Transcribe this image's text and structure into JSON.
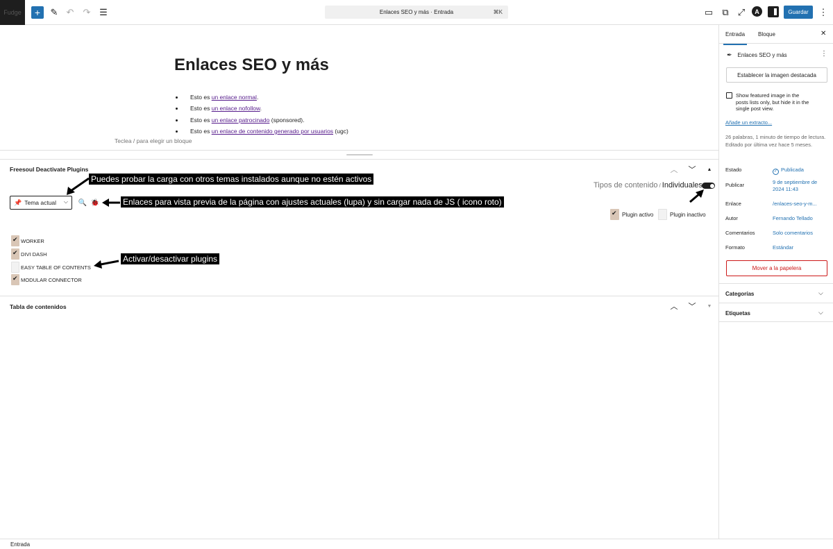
{
  "topbar": {
    "site_label": "Fudge",
    "command": "Enlaces SEO y más · Entrada",
    "shortcut": "⌘K",
    "save": "Guardar",
    "avatar_letter": "A"
  },
  "post": {
    "title": "Enlaces SEO y más",
    "items": [
      {
        "prefix": "Esto es ",
        "link": "un enlace normal",
        "suffix": "."
      },
      {
        "prefix": "Esto es ",
        "link": "un enlace nofollow",
        "suffix": "."
      },
      {
        "prefix": "Esto es ",
        "link": "un enlace patrocinado",
        "suffix": " (sponsored)."
      },
      {
        "prefix": "Esto es ",
        "link": "un enlace de contenido generado por usuarios",
        "suffix": " (ugc)"
      }
    ],
    "block_hint": "Teclea / para elegir un bloque"
  },
  "metabox": {
    "title": "Freesoul Deactivate Plugins",
    "tipos": "Tipos de contenido",
    "separator": "/",
    "individuales": "Individuales",
    "theme_select": "Tema actual",
    "legend_active": "Plugin activo",
    "legend_inactive": "Plugin inactivo",
    "plugins": [
      {
        "name": "WORKER",
        "active": true
      },
      {
        "name": "DIVI DASH",
        "active": true
      },
      {
        "name": "EASY TABLE OF CONTENTS",
        "active": false
      },
      {
        "name": "MODULAR CONNECTOR",
        "active": true
      }
    ],
    "callouts": {
      "themes": "Puedes probar la carga con otros temas instalados aunque no estén activos",
      "preview": "Enlaces para vista previa de la página con ajustes actuales (lupa) y sin cargar nada de JS ( icono roto)",
      "toggle": "Activar/desactivar plugins"
    }
  },
  "toc": {
    "title": "Tabla de contenidos"
  },
  "sidebar": {
    "tab_post": "Entrada",
    "tab_block": "Bloque",
    "post_name": "Enlaces SEO y más",
    "featured_button": "Establecer la imagen destacada",
    "show_featured": "Show featured image in the posts lists only, but hide it in the single post view.",
    "excerpt_link": "Añade un extracto...",
    "word_info": "26 palabras, 1 minuto de tiempo de lectura.",
    "edited_info": "Editado por última vez hace 5 meses.",
    "fields": [
      {
        "label": "Estado",
        "value": "Publicada"
      },
      {
        "label": "Publicar",
        "value": "9 de septiembre de 2024 11:43"
      },
      {
        "label": "Enlace",
        "value": "/enlaces-seo-y-m..."
      },
      {
        "label": "Autor",
        "value": "Fernando Tellado"
      },
      {
        "label": "Comentarios",
        "value": "Solo comentarios"
      },
      {
        "label": "Formato",
        "value": "Estándar"
      }
    ],
    "trash": "Mover a la papelera",
    "panels": [
      "Categorías",
      "Etiquetas"
    ]
  },
  "footer": {
    "breadcrumb": "Entrada"
  },
  "colors": {
    "accent": "#2271b1",
    "danger": "#cc1818",
    "checkbox": "#d9c6b6"
  }
}
